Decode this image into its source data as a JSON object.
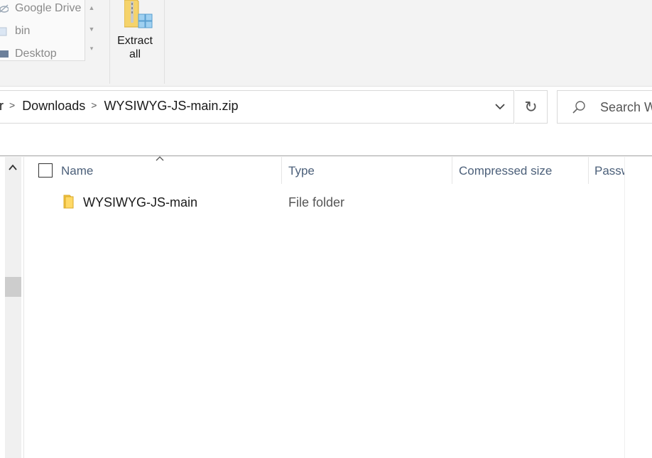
{
  "ribbon": {
    "quick_access": [
      {
        "label": "Google Drive",
        "icon": "cloud-sync-icon"
      },
      {
        "label": "bin",
        "icon": "folder-icon"
      },
      {
        "label": "Desktop",
        "icon": "desktop-icon"
      }
    ],
    "extract_all": {
      "line1": "Extract",
      "line2": "all",
      "icon": "extract-zip-icon"
    }
  },
  "address": {
    "crumbs": [
      "r",
      "Downloads",
      "WYSIWYG-JS-main.zip"
    ],
    "dropdown_icon": "chevron-down-icon",
    "refresh_icon": "refresh-icon"
  },
  "search": {
    "placeholder": "Search W",
    "icon": "search-icon"
  },
  "file_list": {
    "columns": [
      "Name",
      "Type",
      "Compressed size",
      "Passw"
    ],
    "rows": [
      {
        "name": "WYSIWYG-JS-main",
        "type": "File folder",
        "icon": "folder-icon"
      }
    ]
  },
  "colors": {
    "header_text": "#4c607a",
    "folder": "#f5c842",
    "accent": "#1a1a1a"
  }
}
